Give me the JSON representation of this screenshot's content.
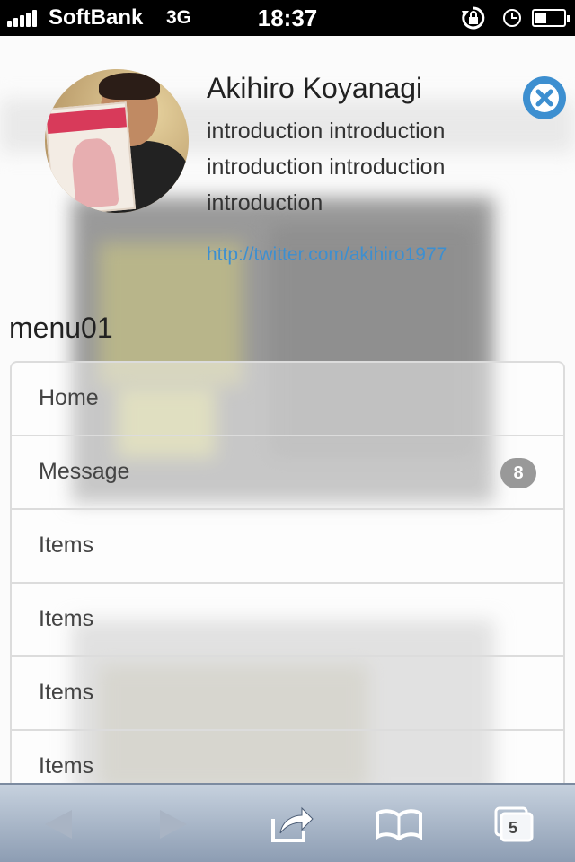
{
  "status_bar": {
    "carrier": "SoftBank",
    "network": "3G",
    "time": "18:37",
    "icons": [
      "signal-icon",
      "rotation-lock-icon",
      "alarm-clock-icon",
      "battery-icon"
    ]
  },
  "profile": {
    "name": "Akihiro Koyanagi",
    "intro": "introduction introduction introduction introduction introduction",
    "link": "http://twitter.com/akihiro1977",
    "avatar": "avatar-photo",
    "close_icon": "close-circle-icon"
  },
  "menu": {
    "title": "menu01",
    "items": [
      {
        "label": "Home",
        "badge": ""
      },
      {
        "label": "Message",
        "badge": "8"
      },
      {
        "label": "Items",
        "badge": ""
      },
      {
        "label": "Items",
        "badge": ""
      },
      {
        "label": "Items",
        "badge": ""
      },
      {
        "label": "Items",
        "badge": ""
      }
    ]
  },
  "toolbar": {
    "tab_count": "5",
    "icons": [
      "back-arrow-icon",
      "forward-arrow-icon",
      "share-icon",
      "bookmarks-icon",
      "tabs-icon"
    ]
  },
  "colors": {
    "accent": "#3d8fd0",
    "badge": "#999999",
    "toolbar_top": "#c6d1de",
    "toolbar_bottom": "#8d9db3"
  }
}
